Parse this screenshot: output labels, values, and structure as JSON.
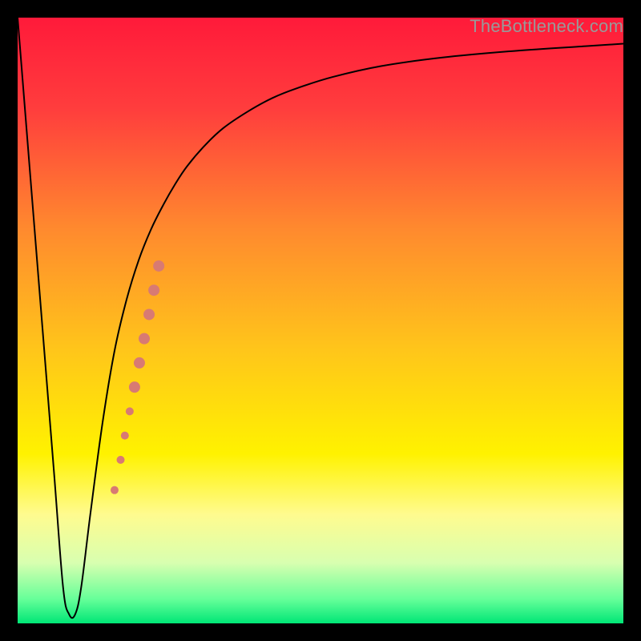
{
  "watermark": "TheBottleneck.com",
  "chart_data": {
    "type": "line",
    "title": "",
    "xlabel": "",
    "ylabel": "",
    "xlim": [
      0,
      100
    ],
    "ylim": [
      0,
      100
    ],
    "background": {
      "type": "vertical-gradient",
      "stops": [
        {
          "offset": 0.0,
          "color": "#ff1a3a"
        },
        {
          "offset": 0.15,
          "color": "#ff3d3d"
        },
        {
          "offset": 0.35,
          "color": "#ff8a2e"
        },
        {
          "offset": 0.55,
          "color": "#ffc61a"
        },
        {
          "offset": 0.72,
          "color": "#fff200"
        },
        {
          "offset": 0.82,
          "color": "#fffb8f"
        },
        {
          "offset": 0.9,
          "color": "#d8ffb0"
        },
        {
          "offset": 0.96,
          "color": "#66ff99"
        },
        {
          "offset": 1.0,
          "color": "#00e676"
        }
      ]
    },
    "series": [
      {
        "name": "bottleneck-curve",
        "color": "#000000",
        "stroke_width": 2,
        "x": [
          0,
          2,
          4,
          6,
          7.5,
          8.5,
          9.5,
          10.5,
          12,
          14,
          16,
          18,
          20,
          22,
          24,
          26,
          28,
          31,
          34,
          38,
          42,
          46,
          52,
          60,
          70,
          82,
          94,
          100
        ],
        "y": [
          100,
          75,
          50,
          25,
          6,
          1.5,
          1.5,
          6,
          18,
          33,
          45,
          53.5,
          60,
          65,
          69,
          72.5,
          75.5,
          79,
          81.8,
          84.5,
          86.7,
          88.3,
          90.2,
          92,
          93.4,
          94.5,
          95.3,
          95.7
        ]
      }
    ],
    "markers": {
      "name": "highlight-segment",
      "color": "#d87a73",
      "points": [
        {
          "x": 16.0,
          "y": 22.0,
          "r": 5
        },
        {
          "x": 17.0,
          "y": 27.0,
          "r": 5
        },
        {
          "x": 17.7,
          "y": 31.0,
          "r": 5
        },
        {
          "x": 18.5,
          "y": 35.0,
          "r": 5
        },
        {
          "x": 19.3,
          "y": 39.0,
          "r": 7
        },
        {
          "x": 20.1,
          "y": 43.0,
          "r": 7
        },
        {
          "x": 20.9,
          "y": 47.0,
          "r": 7
        },
        {
          "x": 21.7,
          "y": 51.0,
          "r": 7
        },
        {
          "x": 22.5,
          "y": 55.0,
          "r": 7
        },
        {
          "x": 23.3,
          "y": 59.0,
          "r": 7
        }
      ]
    }
  }
}
